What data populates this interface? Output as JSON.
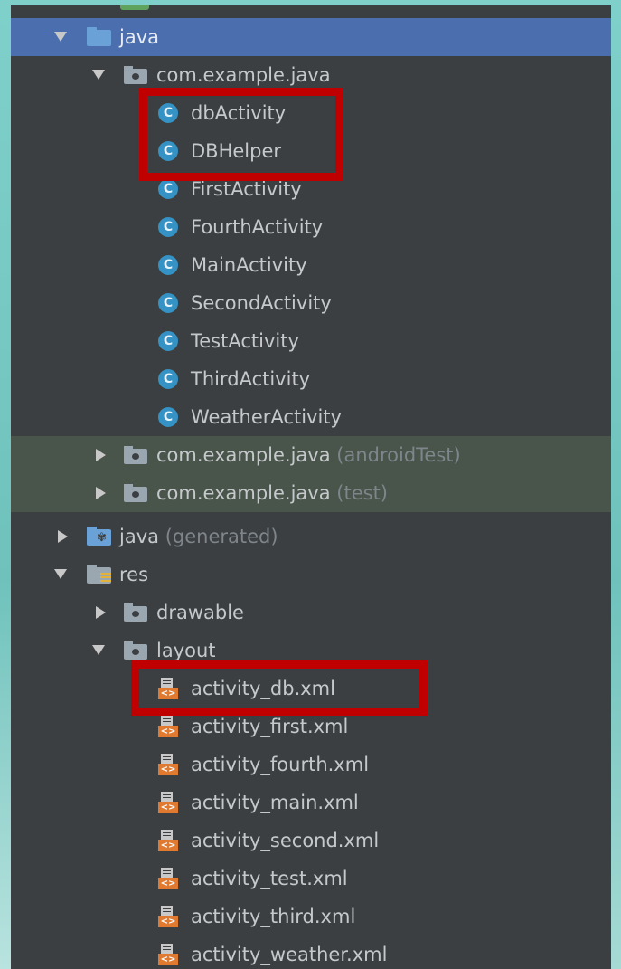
{
  "tree": {
    "rows": [
      {
        "label": "java",
        "suffix": "",
        "icon": "source-folder-icon"
      },
      {
        "label": "com.example.java",
        "suffix": "",
        "icon": "package-icon"
      },
      {
        "label": "dbActivity",
        "suffix": "",
        "icon": "class-icon"
      },
      {
        "label": "DBHelper",
        "suffix": "",
        "icon": "class-icon"
      },
      {
        "label": "FirstActivity",
        "suffix": "",
        "icon": "class-icon"
      },
      {
        "label": "FourthActivity",
        "suffix": "",
        "icon": "class-icon"
      },
      {
        "label": "MainActivity",
        "suffix": "",
        "icon": "class-icon"
      },
      {
        "label": "SecondActivity",
        "suffix": "",
        "icon": "class-icon"
      },
      {
        "label": "TestActivity",
        "suffix": "",
        "icon": "class-icon"
      },
      {
        "label": "ThirdActivity",
        "suffix": "",
        "icon": "class-icon"
      },
      {
        "label": "WeatherActivity",
        "suffix": "",
        "icon": "class-icon"
      },
      {
        "label": "com.example.java",
        "suffix": "(androidTest)",
        "icon": "package-icon"
      },
      {
        "label": "com.example.java",
        "suffix": "(test)",
        "icon": "package-icon"
      },
      {
        "label": "java",
        "suffix": "(generated)",
        "icon": "generated-folder-icon"
      },
      {
        "label": "res",
        "suffix": "",
        "icon": "resource-folder-icon"
      },
      {
        "label": "drawable",
        "suffix": "",
        "icon": "package-icon"
      },
      {
        "label": "layout",
        "suffix": "",
        "icon": "package-icon"
      },
      {
        "label": "activity_db.xml",
        "suffix": "",
        "icon": "xml-file-icon"
      },
      {
        "label": "activity_first.xml",
        "suffix": "",
        "icon": "xml-file-icon"
      },
      {
        "label": "activity_fourth.xml",
        "suffix": "",
        "icon": "xml-file-icon"
      },
      {
        "label": "activity_main.xml",
        "suffix": "",
        "icon": "xml-file-icon"
      },
      {
        "label": "activity_second.xml",
        "suffix": "",
        "icon": "xml-file-icon"
      },
      {
        "label": "activity_test.xml",
        "suffix": "",
        "icon": "xml-file-icon"
      },
      {
        "label": "activity_third.xml",
        "suffix": "",
        "icon": "xml-file-icon"
      },
      {
        "label": "activity_weather.xml",
        "suffix": "",
        "icon": "xml-file-icon"
      }
    ],
    "class_icon_glyph": "C",
    "xml_icon_glyph": "<>"
  },
  "colors": {
    "panel_bg": "#3c3f41",
    "selection": "#4b6eaf",
    "test_tint": "#49544a",
    "highlight_box": "#c00000",
    "class_icon": "#3592c4",
    "xml_icon": "#e07a31"
  }
}
